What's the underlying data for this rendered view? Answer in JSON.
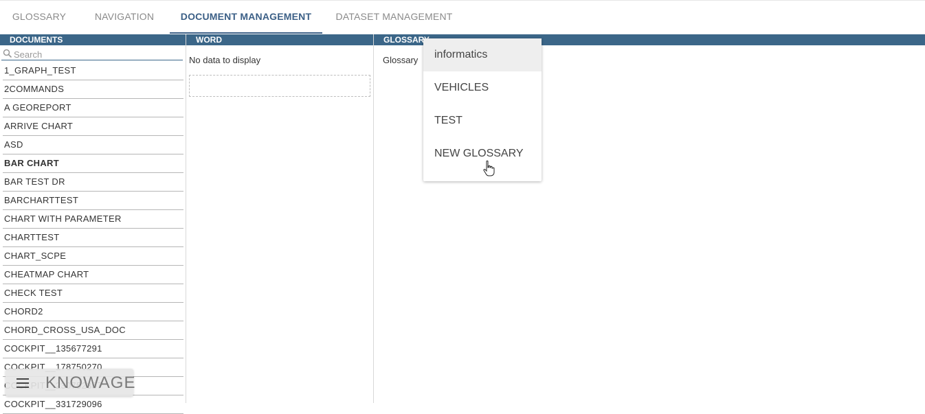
{
  "tabs": [
    {
      "label": "GLOSSARY",
      "active": false
    },
    {
      "label": "NAVIGATION",
      "active": false
    },
    {
      "label": "DOCUMENT MANAGEMENT",
      "active": true
    },
    {
      "label": "DATASET MANAGEMENT",
      "active": false
    }
  ],
  "documents": {
    "header": "DOCUMENTS",
    "search_placeholder": "Search",
    "items": [
      {
        "label": "1_GRAPH_TEST"
      },
      {
        "label": "2COMMANDS"
      },
      {
        "label": "A GEOREPORT"
      },
      {
        "label": "ARRIVE CHART"
      },
      {
        "label": "ASD"
      },
      {
        "label": "BAR CHART",
        "selected": true
      },
      {
        "label": "BAR TEST DR"
      },
      {
        "label": "BARCHARTTEST"
      },
      {
        "label": "CHART WITH PARAMETER"
      },
      {
        "label": "CHARTTEST"
      },
      {
        "label": "CHART_SCPE"
      },
      {
        "label": "CHEATMAP CHART"
      },
      {
        "label": "CHECK TEST"
      },
      {
        "label": "CHORD2"
      },
      {
        "label": "CHORD_CROSS_USA_DOC"
      },
      {
        "label": "COCKPIT__135677291"
      },
      {
        "label": "COCKPIT__178750270"
      },
      {
        "label": "COCKPIT__230752357"
      },
      {
        "label": "COCKPIT__331729096"
      }
    ]
  },
  "word": {
    "header": "WORD",
    "empty_text": "No data to display"
  },
  "glossary": {
    "header": "GLOSSARY",
    "select_label": "Glossary",
    "options": [
      {
        "label": "informatics",
        "highlighted": true
      },
      {
        "label": "VEHICLES"
      },
      {
        "label": "TEST"
      },
      {
        "label": "NEW GLOSSARY"
      }
    ]
  },
  "footer": {
    "logo_text": "KNOWAGE",
    "menu_icon": "hamburger-menu-icon"
  },
  "colors": {
    "header_bg": "#3b6688",
    "active_tab": "#3b5f86",
    "logo_accent": "#d9534f"
  }
}
